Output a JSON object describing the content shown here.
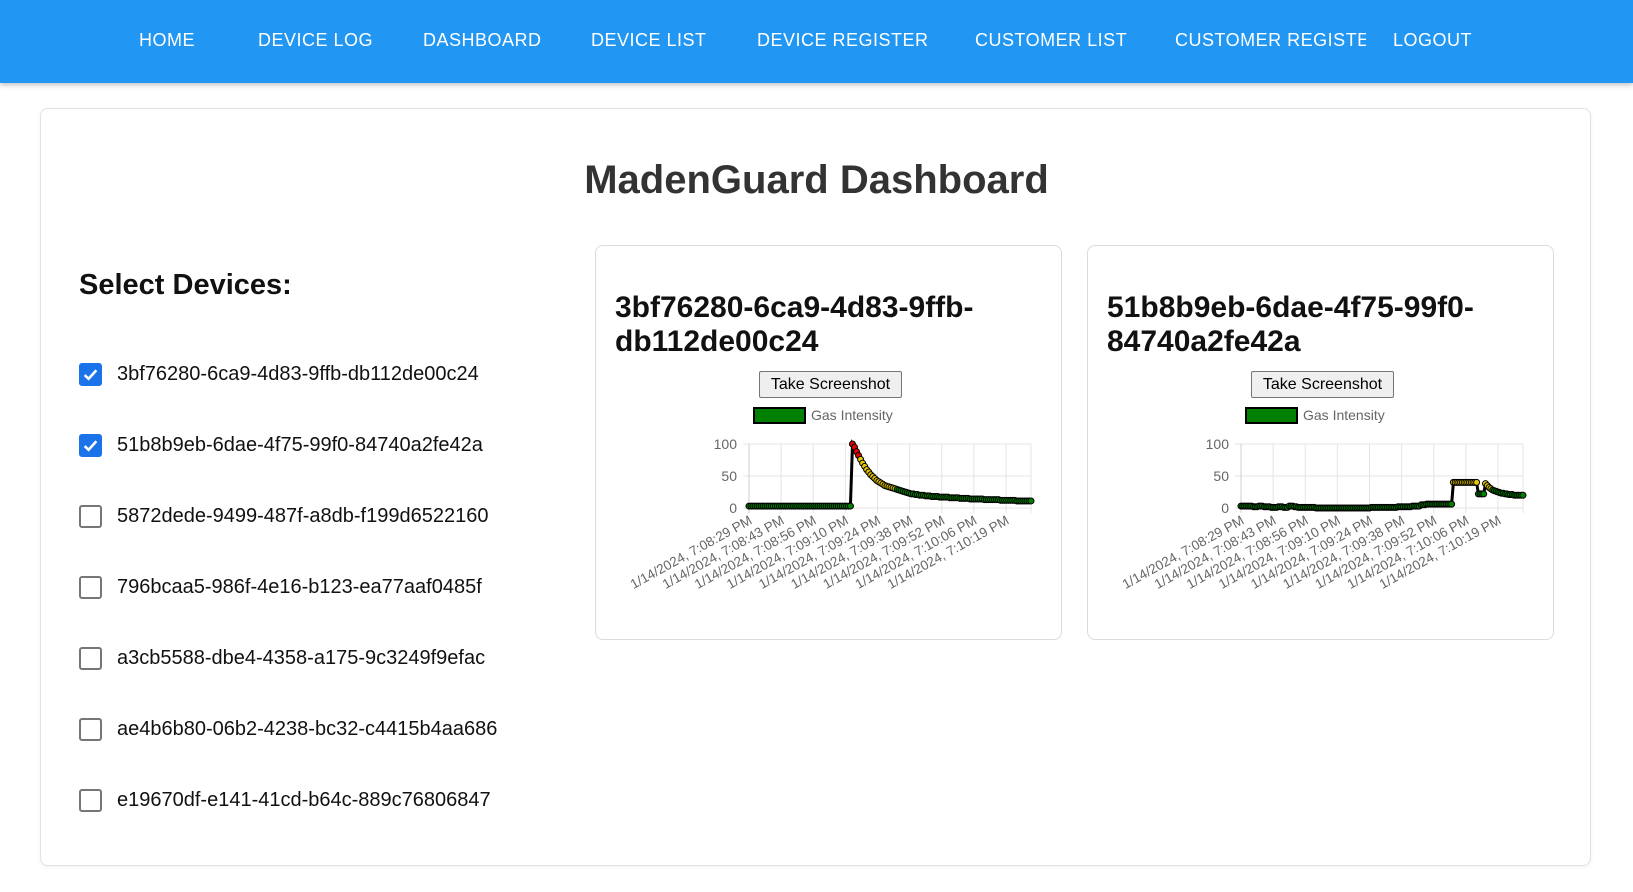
{
  "nav": {
    "items": [
      "HOME",
      "DEVICE LOG",
      "DASHBOARD",
      "DEVICE LIST",
      "DEVICE REGISTER",
      "CUSTOMER LIST",
      "CUSTOMER REGISTER",
      "LOGOUT"
    ]
  },
  "page": {
    "title": "MadenGuard Dashboard"
  },
  "devices": {
    "title": "Select Devices:",
    "items": [
      {
        "id": "3bf76280-6ca9-4d83-9ffb-db112de00c24",
        "checked": true
      },
      {
        "id": "51b8b9eb-6dae-4f75-99f0-84740a2fe42a",
        "checked": true
      },
      {
        "id": "5872dede-9499-487f-a8db-f199d6522160",
        "checked": false
      },
      {
        "id": "796bcaa5-986f-4e16-b123-ea77aaf0485f",
        "checked": false
      },
      {
        "id": "a3cb5588-dbe4-4358-a175-9c3249f9efac",
        "checked": false
      },
      {
        "id": "ae4b6b80-06b2-4238-bc32-c4415b4aa686",
        "checked": false
      },
      {
        "id": "e19670df-e141-41cd-b64c-889c76806847",
        "checked": false
      }
    ]
  },
  "screenshot_label": "Take Screenshot",
  "colors": {
    "nav": "#2196f3",
    "accent": "#1a73e8",
    "low": "#008000",
    "mid": "#e6c700",
    "high": "#e00000"
  },
  "chart_data": [
    {
      "type": "line",
      "title": "3bf76280-6ca9-4d83-9ffb-db112de00c24",
      "title_lines": [
        "3bf76280-6ca9-4d83-9ffb-",
        "db112de00c24"
      ],
      "series": [
        {
          "name": "Gas Intensity",
          "values": [
            3,
            3,
            3,
            3,
            3,
            3,
            3,
            3,
            3,
            3,
            3,
            3,
            3,
            3,
            3,
            3,
            3,
            3,
            3,
            3,
            3,
            3,
            3,
            3,
            3,
            3,
            3,
            3,
            3,
            3,
            3,
            3,
            3,
            3,
            3,
            3,
            3,
            3,
            3,
            3,
            3,
            3,
            3,
            3,
            3,
            3,
            3,
            3,
            3,
            3,
            3,
            100,
            95,
            88,
            82,
            76,
            70,
            65,
            60,
            56,
            52,
            49,
            46,
            43,
            41,
            39,
            37,
            35,
            34,
            33,
            32,
            31,
            30,
            29,
            28,
            27,
            26,
            25,
            24,
            23,
            22,
            22,
            21,
            21,
            20,
            20,
            20,
            19,
            19,
            19,
            18,
            18,
            18,
            18,
            17,
            17,
            17,
            17,
            17,
            16,
            16,
            16,
            16,
            16,
            15,
            15,
            15,
            15,
            15,
            14,
            14,
            14,
            14,
            14,
            14,
            14,
            13,
            13,
            13,
            13,
            13,
            13,
            13,
            13,
            12,
            12,
            12,
            12,
            12,
            12,
            12,
            12,
            11,
            11,
            11,
            11,
            11,
            11,
            11,
            11
          ]
        }
      ],
      "x_tick_labels": [
        "1/14/2024, 7:08:29 PM",
        "1/14/2024, 7:08:43 PM",
        "1/14/2024, 7:08:56 PM",
        "1/14/2024, 7:09:10 PM",
        "1/14/2024, 7:09:24 PM",
        "1/14/2024, 7:09:38 PM",
        "1/14/2024, 7:09:52 PM",
        "1/14/2024, 7:10:06 PM",
        "1/14/2024, 7:10:19 PM"
      ],
      "y_ticks": [
        0,
        50,
        100
      ],
      "ylim": [
        0,
        100
      ],
      "legend": "top-center",
      "grid": true
    },
    {
      "type": "line",
      "title": "51b8b9eb-6dae-4f75-99f0-84740a2fe42a",
      "title_lines": [
        "51b8b9eb-6dae-4f75-99f0-",
        "84740a2fe42a"
      ],
      "series": [
        {
          "name": "Gas Intensity",
          "values": [
            3,
            3,
            3,
            3,
            3,
            3,
            3,
            2,
            2,
            2,
            3,
            3,
            3,
            2,
            2,
            2,
            2,
            1,
            1,
            1,
            1,
            2,
            2,
            2,
            1,
            1,
            1,
            3,
            3,
            3,
            2,
            2,
            1,
            1,
            1,
            1,
            1,
            1,
            1,
            1,
            1,
            1,
            0,
            0,
            0,
            0,
            0,
            0,
            0,
            0,
            0,
            0,
            0,
            0,
            0,
            0,
            0,
            0,
            0,
            0,
            0,
            0,
            0,
            0,
            0,
            0,
            0,
            0,
            0,
            0,
            0,
            0,
            0,
            1,
            1,
            1,
            1,
            1,
            1,
            1,
            1,
            1,
            1,
            1,
            1,
            1,
            1,
            1,
            2,
            2,
            2,
            2,
            2,
            2,
            2,
            2,
            3,
            3,
            3,
            3,
            3,
            5,
            5,
            5,
            6,
            6,
            6,
            6,
            6,
            6,
            6,
            6,
            6,
            6,
            6,
            6,
            6,
            6,
            6,
            40,
            40,
            40,
            40,
            40,
            40,
            40,
            40,
            40,
            40,
            40,
            40,
            40,
            40,
            22,
            22,
            22,
            22,
            38,
            35,
            32,
            30,
            28,
            27,
            26,
            25,
            24,
            23,
            23,
            22,
            22,
            21,
            21,
            21,
            20,
            20,
            20,
            20,
            20,
            20
          ]
        }
      ],
      "x_tick_labels": [
        "1/14/2024, 7:08:29 PM",
        "1/14/2024, 7:08:43 PM",
        "1/14/2024, 7:08:56 PM",
        "1/14/2024, 7:09:10 PM",
        "1/14/2024, 7:09:24 PM",
        "1/14/2024, 7:09:38 PM",
        "1/14/2024, 7:09:52 PM",
        "1/14/2024, 7:10:06 PM",
        "1/14/2024, 7:10:19 PM"
      ],
      "y_ticks": [
        0,
        50,
        100
      ],
      "ylim": [
        0,
        100
      ],
      "legend": "top-center",
      "grid": true
    }
  ]
}
